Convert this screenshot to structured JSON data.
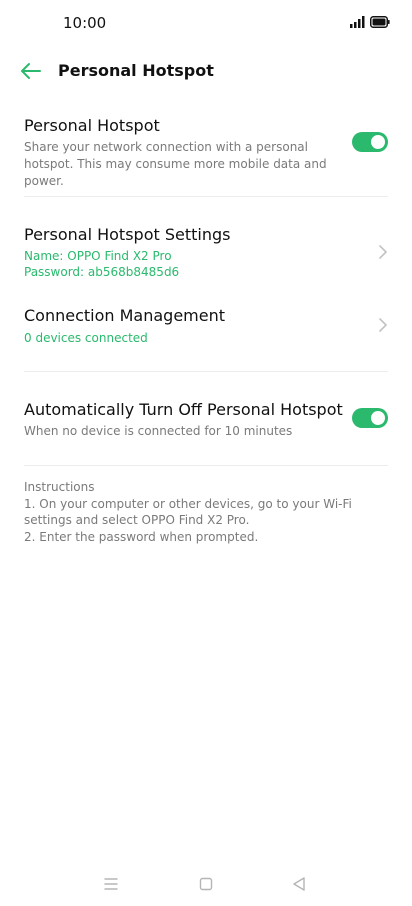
{
  "status_bar": {
    "time": "10:00"
  },
  "header": {
    "title": "Personal Hotspot",
    "back_icon": "back-arrow-icon"
  },
  "hotspot_toggle": {
    "title": "Personal Hotspot",
    "description": "Share your network connection with a personal hotspot. This may consume more mobile data and power.",
    "enabled": true
  },
  "hotspot_settings": {
    "title": "Personal Hotspot Settings",
    "name_line": "Name: OPPO Find X2 Pro",
    "password_line": "Password: ab568b8485d6"
  },
  "connection_management": {
    "title": "Connection Management",
    "status": "0 devices connected"
  },
  "auto_off": {
    "title": "Automatically Turn Off Personal Hotspot",
    "description": "When no device is connected for 10 minutes",
    "enabled": true
  },
  "instructions": {
    "heading": "Instructions",
    "step1": "1. On your computer or other devices, go to your Wi-Fi settings and select OPPO Find X2 Pro.",
    "step2": "2. Enter the password when prompted."
  },
  "colors": {
    "accent": "#2ab96d",
    "text_secondary": "#7a7a7a"
  },
  "nav_bar": {
    "icons": [
      "menu-icon",
      "home-icon",
      "back-icon"
    ]
  }
}
